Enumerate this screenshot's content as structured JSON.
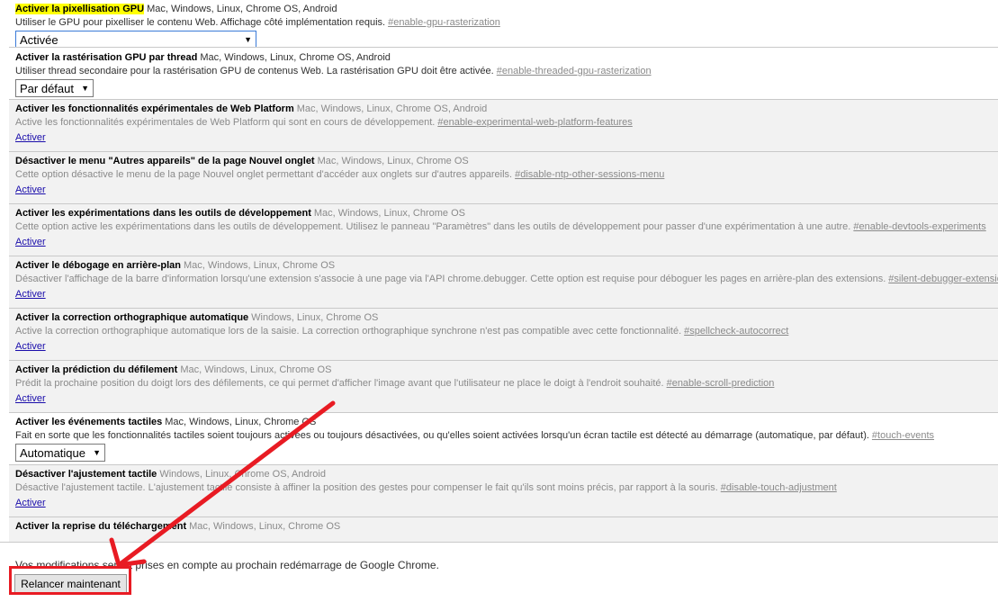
{
  "flags": [
    {
      "name": "Activer la pixellisation GPU",
      "platforms": "Mac, Windows, Linux, Chrome OS, Android",
      "description": "Utiliser le GPU pour pixelliser le contenu Web. Affichage côté implémentation requis.",
      "ref": "#enable-gpu-rasterization",
      "control": "select",
      "value": "Activée",
      "highlight": true,
      "enabled": true
    },
    {
      "name": "Activer la rastérisation GPU par thread",
      "platforms": "Mac, Windows, Linux, Chrome OS, Android",
      "description": "Utiliser thread secondaire pour la rastérisation GPU de contenus Web. La rastérisation GPU doit être activée.",
      "ref": "#enable-threaded-gpu-rasterization",
      "control": "select",
      "value": "Par défaut",
      "enabled": true
    },
    {
      "name": "Activer les fonctionnalités expérimentales de Web Platform",
      "platforms": "Mac, Windows, Linux, Chrome OS, Android",
      "description": "Active les fonctionnalités expérimentales de Web Platform qui sont en cours de développement.",
      "ref": "#enable-experimental-web-platform-features",
      "control": "link",
      "value": "Activer",
      "enabled": false
    },
    {
      "name": "Désactiver le menu \"Autres appareils\" de la page Nouvel onglet",
      "platforms": "Mac, Windows, Linux, Chrome OS",
      "description": "Cette option désactive le menu de la page Nouvel onglet permettant d'accéder aux onglets sur d'autres appareils.",
      "ref": "#disable-ntp-other-sessions-menu",
      "control": "link",
      "value": "Activer",
      "enabled": false
    },
    {
      "name": "Activer les expérimentations dans les outils de développement",
      "platforms": "Mac, Windows, Linux, Chrome OS",
      "description": "Cette option active les expérimentations dans les outils de développement. Utilisez le panneau \"Paramètres\" dans les outils de développement pour passer d'une expérimentation à une autre.",
      "ref": "#enable-devtools-experiments",
      "control": "link",
      "value": "Activer",
      "enabled": false
    },
    {
      "name": "Activer le débogage en arrière-plan",
      "platforms": "Mac, Windows, Linux, Chrome OS",
      "description": "Désactiver l'affichage de la barre d'information lorsqu'une extension s'associe à une page via l'API chrome.debugger. Cette option est requise pour déboguer les pages en arrière-plan des extensions.",
      "ref": "#silent-debugger-extension-api",
      "control": "link",
      "value": "Activer",
      "enabled": false
    },
    {
      "name": "Activer la correction orthographique automatique",
      "platforms": "Windows, Linux, Chrome OS",
      "description": "Active la correction orthographique automatique lors de la saisie. La correction orthographique synchrone n'est pas compatible avec cette fonctionnalité.",
      "ref": "#spellcheck-autocorrect",
      "control": "link",
      "value": "Activer",
      "enabled": false
    },
    {
      "name": "Activer la prédiction du défilement",
      "platforms": "Mac, Windows, Linux, Chrome OS",
      "description": "Prédit la prochaine position du doigt lors des défilements, ce qui permet d'afficher l'image avant que l'utilisateur ne place le doigt à l'endroit souhaité.",
      "ref": "#enable-scroll-prediction",
      "control": "link",
      "value": "Activer",
      "enabled": false
    },
    {
      "name": "Activer les événements tactiles",
      "platforms": "Mac, Windows, Linux, Chrome OS",
      "description": "Fait en sorte que les fonctionnalités tactiles soient toujours activées ou toujours désactivées, ou qu'elles soient activées lorsqu'un écran tactile est détecté au démarrage (automatique, par défaut).",
      "ref": "#touch-events",
      "control": "select",
      "value": "Automatique",
      "enabled": true
    },
    {
      "name": "Désactiver l'ajustement tactile",
      "platforms": "Windows, Linux, Chrome OS, Android",
      "description": "Désactive l'ajustement tactile. L'ajustement tactile consiste à affiner la position des gestes pour compenser le fait qu'ils sont moins précis, par rapport à la souris.",
      "ref": "#disable-touch-adjustment",
      "control": "link",
      "value": "Activer",
      "enabled": false
    },
    {
      "name": "Activer la reprise du téléchargement",
      "platforms": "Mac, Windows, Linux, Chrome OS",
      "description": "",
      "ref": "",
      "control": "none",
      "value": "",
      "enabled": false
    }
  ],
  "footer": {
    "notice": "Vos modifications seront prises en compte au prochain redémarrage de Google Chrome.",
    "relaunch_label": "Relancer maintenant"
  },
  "annotation": {
    "color": "#e81b23"
  }
}
